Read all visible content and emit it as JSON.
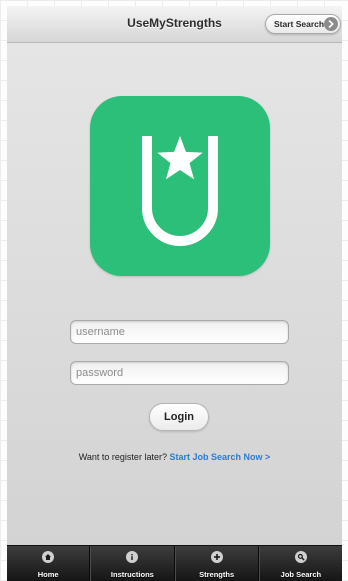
{
  "header": {
    "title": "UseMyStrengths",
    "start_search_label": "Start Search"
  },
  "logo": {
    "icon": "usemystrengths-logo-icon",
    "background_color": "#2bbf79",
    "foreground_color": "#ffffff"
  },
  "login_form": {
    "username_placeholder": "username",
    "username_value": "",
    "password_placeholder": "password",
    "password_value": "",
    "login_label": "Login"
  },
  "register": {
    "prompt": "Want to register later?",
    "link_label": "Start Job Search Now >"
  },
  "colors": {
    "accent_link": "#2c7bd1",
    "tabbar_background": "#1f1f1f"
  },
  "tabbar": {
    "items": [
      {
        "label": "Home",
        "icon": "home-icon"
      },
      {
        "label": "Instructions",
        "icon": "info-icon"
      },
      {
        "label": "Strengths",
        "icon": "plus-icon"
      },
      {
        "label": "Job Search",
        "icon": "search-icon"
      }
    ]
  }
}
